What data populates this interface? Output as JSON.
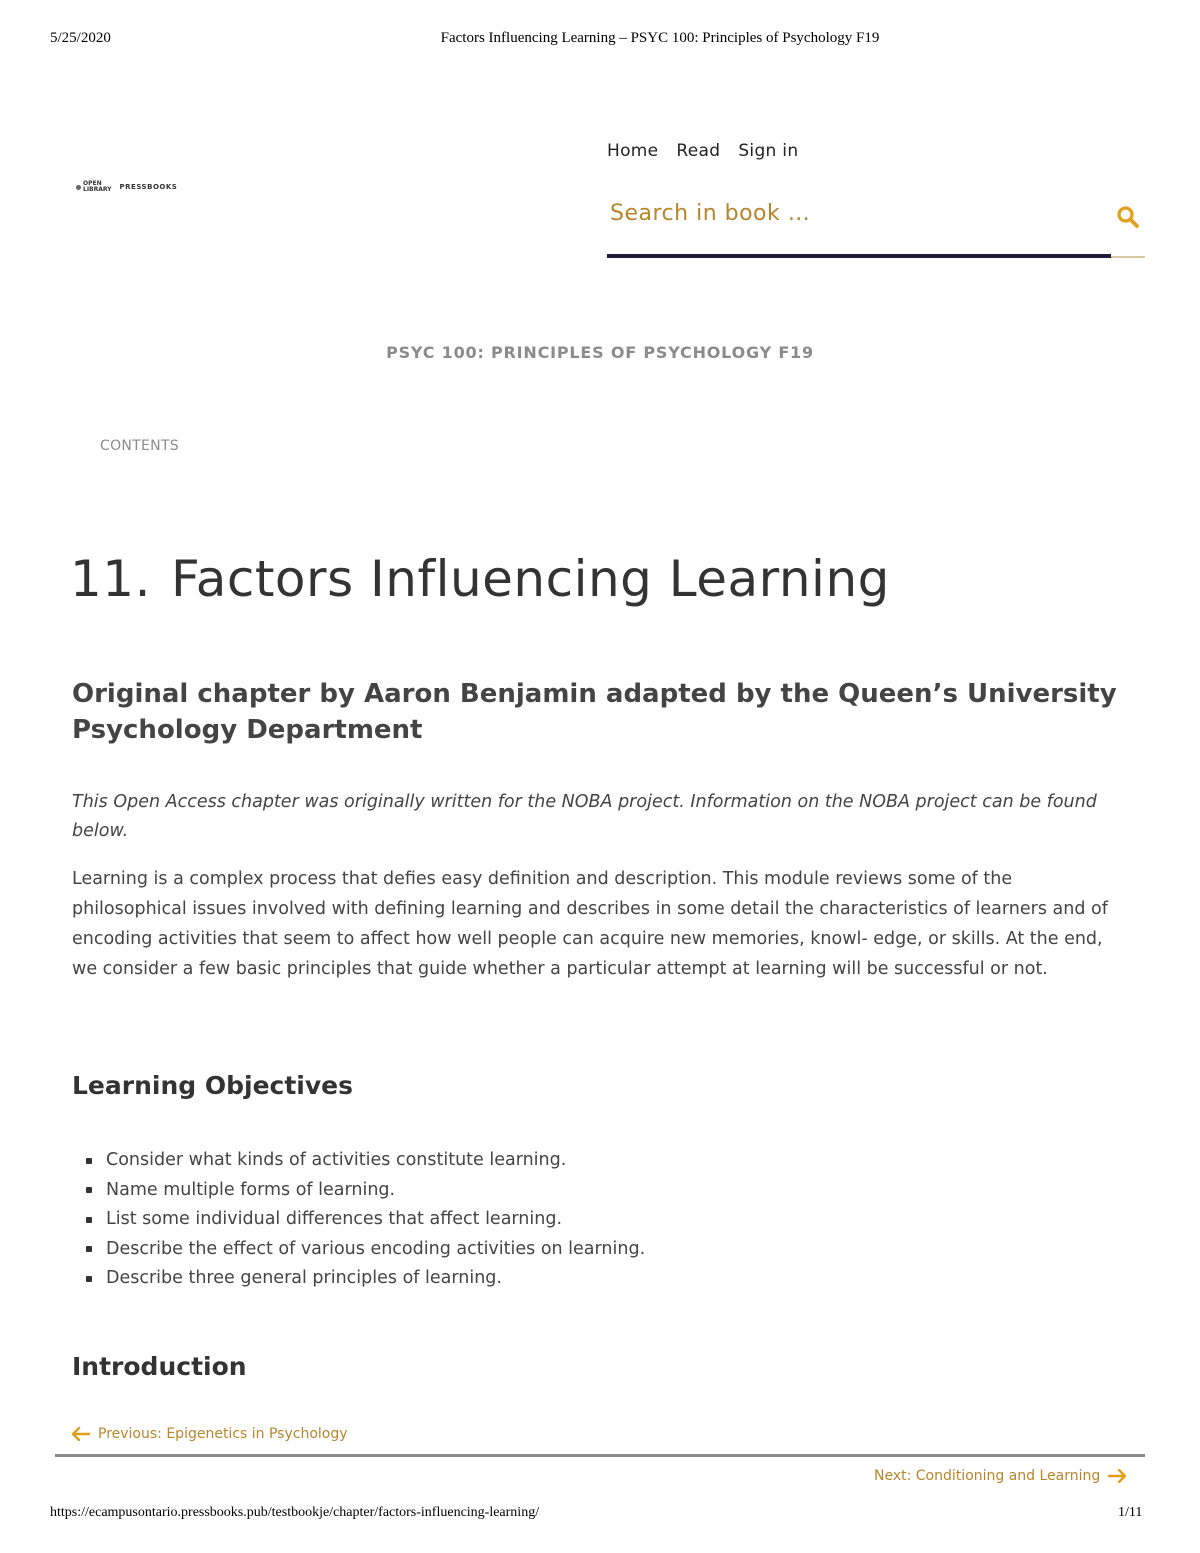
{
  "print_header": {
    "date": "5/25/2020",
    "page_title": "Factors Influencing Learning – PSYC 100: Principles of Psychology F19"
  },
  "logo": {
    "line1": "Open",
    "line2": "Library",
    "pressbooks": "PRESSBOOKS"
  },
  "topnav": {
    "items": [
      "Home",
      "Read",
      "Sign in"
    ]
  },
  "search": {
    "placeholder": "Search in book …",
    "icon": "search-icon"
  },
  "book_title": "PSYC 100: PRINCIPLES OF PSYCHOLOGY F19",
  "contents_label": "CONTENTS",
  "chapter": {
    "number": "11.",
    "title": "Factors Influencing Learning",
    "subtitle": "Original chapter by Aaron Benjamin adapted by the Queen’s University Psychology Department",
    "italic_note": "This Open Access chapter was originally written for the NOBA project. Information on the NOBA project can be found below.",
    "abstract": "Learning is a complex process that defies easy definition and description. This module reviews some of the philosophical issues involved with defining learning and describes in some detail the characteristics of learners and of encoding activities that seem to affect how well people can acquire new memories, knowl- edge, or skills. At the end, we consider a few basic principles that guide whether a particular attempt at learning will be successful or not."
  },
  "objectives": {
    "heading": "Learning Objectives",
    "items": [
      "Consider what kinds of activities constitute learning.",
      "Name multiple forms of learning.",
      "List some individual differences that affect learning.",
      "Describe the effect of various encoding activities on learning.",
      "Describe three general principles of learning."
    ]
  },
  "introduction_heading": "Introduction",
  "pagination": {
    "previous": "Previous: Epigenetics in Psychology",
    "next": "Next: Conditioning and Learning"
  },
  "print_footer": {
    "url": "https://ecampusontario.pressbooks.pub/testbookje/chapter/factors-influencing-learning/",
    "page": "1/11"
  },
  "colors": {
    "accent": "#b5862c",
    "search_underline": "#1f1d3a",
    "muted": "#8b8b8b"
  }
}
